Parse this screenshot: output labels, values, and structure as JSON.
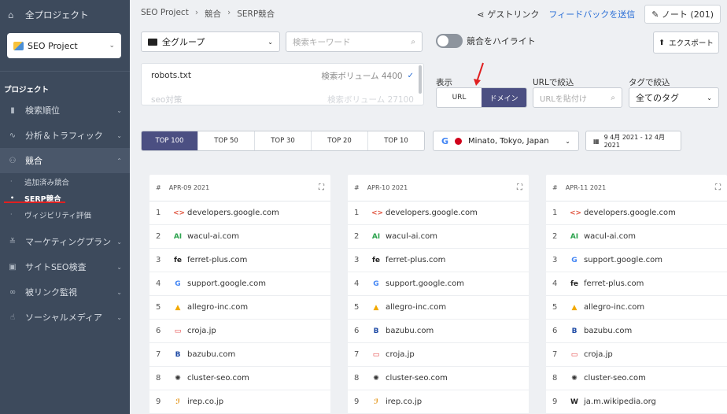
{
  "sidebar": {
    "all_projects": "全プロジェクト",
    "project_name": "SEO Project",
    "section_title": "プロジェクト",
    "items": [
      {
        "label": "検索順位",
        "icon": "bar-chart-icon"
      },
      {
        "label": "分析＆トラフィック",
        "icon": "pulse-icon"
      },
      {
        "label": "競合",
        "icon": "people-icon"
      },
      {
        "label": "マーケティングプラン",
        "icon": "list-check-icon"
      },
      {
        "label": "サイトSEO検査",
        "icon": "audit-icon"
      },
      {
        "label": "被リンク監視",
        "icon": "link-icon"
      },
      {
        "label": "ソーシャルメディア",
        "icon": "thumbs-up-icon"
      }
    ],
    "sub_items": [
      "追加済み競合",
      "SERP競合",
      "ヴィジビリティ評価"
    ]
  },
  "breadcrumb": [
    "SEO Project",
    "競合",
    "SERP競合"
  ],
  "header": {
    "guest_link": "ゲストリンク",
    "feedback": "フィードバックを送信",
    "note": "ノート (201)"
  },
  "filters": {
    "group": "全グループ",
    "keyword_placeholder": "検索キーワード",
    "highlight_label": "競合をハイライト",
    "export": "エクスポート",
    "display_label": "表示",
    "display_options": [
      "URL",
      "ドメイン"
    ],
    "url_filter_label": "URLで絞込",
    "url_filter_placeholder": "URLを貼付け",
    "tag_filter_label": "タグで絞込",
    "tag_value": "全てのタグ"
  },
  "keywords": [
    {
      "term": "robots.txt",
      "volume": "検索ボリューム 4400"
    },
    {
      "term": "seo対策",
      "volume": "検索ボリューム 27100"
    }
  ],
  "top_tabs": [
    "TOP 100",
    "TOP 50",
    "TOP 30",
    "TOP 20",
    "TOP 10"
  ],
  "location": "Minato, Tokyo, Japan",
  "date_range": "9 4月 2021 - 12 4月 2021",
  "columns": [
    {
      "date": "APR-09 2021",
      "rows": [
        {
          "rank": "1",
          "domain": "developers.google.com",
          "icon": "code-brackets-icon"
        },
        {
          "rank": "2",
          "domain": "wacul-ai.com",
          "icon": "ai-icon"
        },
        {
          "rank": "3",
          "domain": "ferret-plus.com",
          "icon": "fe-icon"
        },
        {
          "rank": "4",
          "domain": "support.google.com",
          "icon": "google-icon"
        },
        {
          "rank": "5",
          "domain": "allegro-inc.com",
          "icon": "allegro-icon"
        },
        {
          "rank": "6",
          "domain": "croja.jp",
          "icon": "croja-icon"
        },
        {
          "rank": "7",
          "domain": "bazubu.com",
          "icon": "bazubu-icon"
        },
        {
          "rank": "8",
          "domain": "cluster-seo.com",
          "icon": "cluster-icon"
        },
        {
          "rank": "9",
          "domain": "irep.co.jp",
          "icon": "irep-icon"
        }
      ]
    },
    {
      "date": "APR-10 2021",
      "rows": [
        {
          "rank": "1",
          "domain": "developers.google.com",
          "icon": "code-brackets-icon"
        },
        {
          "rank": "2",
          "domain": "wacul-ai.com",
          "icon": "ai-icon"
        },
        {
          "rank": "3",
          "domain": "ferret-plus.com",
          "icon": "fe-icon"
        },
        {
          "rank": "4",
          "domain": "support.google.com",
          "icon": "google-icon"
        },
        {
          "rank": "5",
          "domain": "allegro-inc.com",
          "icon": "allegro-icon"
        },
        {
          "rank": "6",
          "domain": "bazubu.com",
          "icon": "bazubu-icon"
        },
        {
          "rank": "7",
          "domain": "croja.jp",
          "icon": "croja-icon"
        },
        {
          "rank": "8",
          "domain": "cluster-seo.com",
          "icon": "cluster-icon"
        },
        {
          "rank": "9",
          "domain": "irep.co.jp",
          "icon": "irep-icon"
        }
      ]
    },
    {
      "date": "APR-11 2021",
      "rows": [
        {
          "rank": "1",
          "domain": "developers.google.com",
          "icon": "code-brackets-icon"
        },
        {
          "rank": "2",
          "domain": "wacul-ai.com",
          "icon": "ai-icon"
        },
        {
          "rank": "3",
          "domain": "support.google.com",
          "icon": "google-icon"
        },
        {
          "rank": "4",
          "domain": "ferret-plus.com",
          "icon": "fe-icon"
        },
        {
          "rank": "5",
          "domain": "allegro-inc.com",
          "icon": "allegro-icon"
        },
        {
          "rank": "6",
          "domain": "bazubu.com",
          "icon": "bazubu-icon"
        },
        {
          "rank": "7",
          "domain": "croja.jp",
          "icon": "croja-icon"
        },
        {
          "rank": "8",
          "domain": "cluster-seo.com",
          "icon": "cluster-icon"
        },
        {
          "rank": "9",
          "domain": "ja.m.wikipedia.org",
          "icon": "wikipedia-icon"
        }
      ]
    }
  ],
  "colors": {
    "sidebar_bg": "#3d4a5c",
    "accent": "#4b4f82",
    "link": "#2b6fd6",
    "annotation_red": "#e02020"
  }
}
